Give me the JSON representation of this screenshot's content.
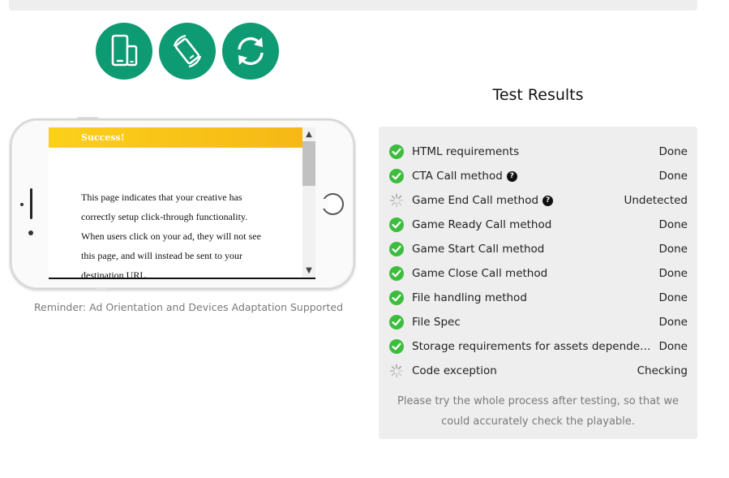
{
  "colors": {
    "accent": "#0e9a73",
    "success": "#3dbd3d",
    "banner": "#fbd01a"
  },
  "device_buttons": [
    {
      "icon": "multi-device-icon"
    },
    {
      "icon": "rotate-phone-icon"
    },
    {
      "icon": "refresh-icon"
    }
  ],
  "preview": {
    "banner": "Success!",
    "lines": [
      "This page indicates that your creative has",
      "correctly setup click-through functionality.",
      "When users click on your ad, they will not see",
      "this page, and will instead be sent to your",
      "destination URL."
    ]
  },
  "reminder": "Reminder: Ad Orientation and Devices Adaptation Supported",
  "results": {
    "title": "Test Results",
    "items": [
      {
        "label": "HTML requirements",
        "status": "Done",
        "state": "done",
        "help": false
      },
      {
        "label": "CTA Call method",
        "status": "Done",
        "state": "done",
        "help": true
      },
      {
        "label": "Game End Call method",
        "status": "Undetected",
        "state": "pending",
        "help": true
      },
      {
        "label": "Game Ready Call method",
        "status": "Done",
        "state": "done",
        "help": false
      },
      {
        "label": "Game Start Call method",
        "status": "Done",
        "state": "done",
        "help": false
      },
      {
        "label": "Game Close Call method",
        "status": "Done",
        "state": "done",
        "help": false
      },
      {
        "label": "File handling method",
        "status": "Done",
        "state": "done",
        "help": false
      },
      {
        "label": "File Spec",
        "status": "Done",
        "state": "done",
        "help": false
      },
      {
        "label": "Storage requirements for assets dependent on...",
        "status": "Done",
        "state": "done",
        "help": false
      },
      {
        "label": "Code exception",
        "status": "Checking",
        "state": "pending",
        "help": false
      }
    ],
    "footnote": "Please try the whole process after testing, so that we could accurately check the playable."
  }
}
